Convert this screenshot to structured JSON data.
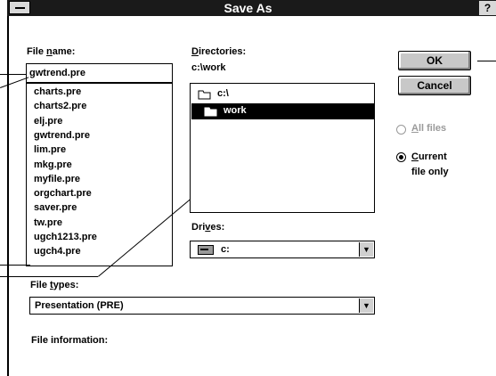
{
  "window": {
    "title": "Save As",
    "help_label": "?"
  },
  "file_name": {
    "label_underlined": "F",
    "label_pre": "ile ",
    "label_under2": "n",
    "label_post": "ame:",
    "value": "gwtrend.pre",
    "files": [
      "charts.pre",
      "charts2.pre",
      "elj.pre",
      "gwtrend.pre",
      "lim.pre",
      "mkg.pre",
      "myfile.pre",
      "orgchart.pre",
      "saver.pre",
      "tw.pre",
      "ugch1213.pre",
      "ugch4.pre"
    ]
  },
  "directories": {
    "label": "Directories:",
    "current_path": "c:\\work",
    "items": [
      {
        "name": "c:\\",
        "selected": false
      },
      {
        "name": "work",
        "selected": true
      }
    ]
  },
  "buttons": {
    "ok": "OK",
    "cancel": "Cancel"
  },
  "save_scope": {
    "all_files": {
      "label": "All files",
      "enabled": false,
      "checked": false
    },
    "current_file_only": {
      "label_line1": "Current",
      "label_line2": "file only",
      "enabled": true,
      "checked": true
    }
  },
  "drives": {
    "label": "Drives:",
    "value": "c:"
  },
  "file_types": {
    "label": "File types:",
    "value": "Presentation (PRE)"
  },
  "file_information": {
    "label": "File information:"
  },
  "icons": [
    "drive-icon",
    "folder-open-icon",
    "folder-icon",
    "dropdown-arrow-icon"
  ]
}
